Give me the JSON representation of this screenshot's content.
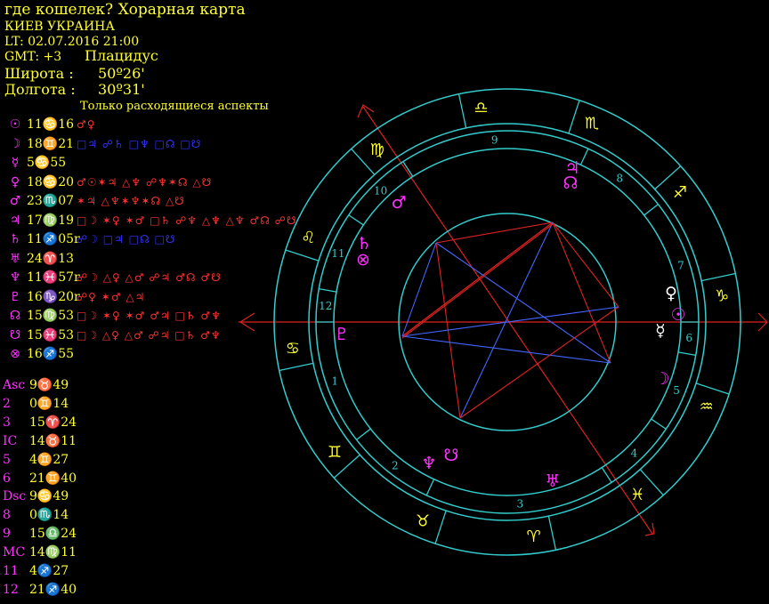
{
  "header": {
    "title": "где кошелек? Хорарная карта",
    "city": "КИЕВ УКРАИНА",
    "local_time": "LT: 02.07.2016  21:00",
    "gmt": "GMT: +3",
    "house_system": "Плацидус",
    "latitude_label": "Широта :",
    "latitude_value": "50º26'",
    "longitude_label": "Долгота :",
    "longitude_value": "30º31'",
    "aspects_note": "Только расходящиеся аспекты"
  },
  "planets": [
    {
      "name": "sun",
      "glyph": "☉",
      "pos": "11♋16",
      "aspects": [
        [
          "♂♀",
          "#ff3333"
        ]
      ]
    },
    {
      "name": "moon",
      "glyph": "☽",
      "pos": "18♊21",
      "aspects": [
        [
          "□♃ ☍♄ □♆ □☊ □☋",
          "#3333ff"
        ]
      ]
    },
    {
      "name": "mercury",
      "glyph": "☿",
      "pos": "5♋55",
      "aspects": []
    },
    {
      "name": "venus",
      "glyph": "♀",
      "pos": "18♋20",
      "aspects": [
        [
          "♂☉✶♃ △♆ ☍♆✶☊ △☋",
          "#ff3333"
        ]
      ]
    },
    {
      "name": "mars",
      "glyph": "♂",
      "pos": "23♏07",
      "aspects": [
        [
          "✶♃ △♆✶♆✶☊ △☋",
          "#ff3333"
        ]
      ]
    },
    {
      "name": "jupiter",
      "glyph": "♃",
      "pos": "17♍19",
      "aspects": [
        [
          "□☽ ✶♀ ✶♂ □♄ ☍♆ △♆ △♆ ♂☊ ☍☋",
          "#ff3333"
        ]
      ]
    },
    {
      "name": "saturn",
      "glyph": "♄",
      "pos": "11♐05r",
      "aspects": [
        [
          "☍☽ □♃ □☊ □☋",
          "#3333ff"
        ]
      ]
    },
    {
      "name": "uranus",
      "glyph": "♅",
      "pos": "24♈13",
      "aspects": []
    },
    {
      "name": "neptune",
      "glyph": "♆",
      "pos": "11♓57r",
      "aspects": [
        [
          "☍☽ △♀ △♂ ☍♃ ♂☊ ♂☋",
          "#ff3333"
        ]
      ]
    },
    {
      "name": "pluto",
      "glyph": "♇",
      "pos": "16♑20r",
      "aspects": [
        [
          "☍♀ ✶♂ △♃",
          "#ff3333"
        ]
      ]
    },
    {
      "name": "north-node",
      "glyph": "☊",
      "pos": "15♍53",
      "aspects": [
        [
          "□☽ ✶♀ ✶♂ ♂♃ □♄ ♂♆",
          "#ff3333"
        ]
      ]
    },
    {
      "name": "south-node",
      "glyph": "☋",
      "pos": "15♓53",
      "aspects": [
        [
          "□☽ △♀ △♂ ☍♃ □♄ ♂♆",
          "#ff3333"
        ]
      ]
    },
    {
      "name": "fortune",
      "glyph": "⊗",
      "pos": "16♐55",
      "aspects": []
    }
  ],
  "cusps": [
    {
      "label": "Asc",
      "pos": "9♉49"
    },
    {
      "label": "2",
      "pos": "0♊14"
    },
    {
      "label": "3",
      "pos": "15♈24"
    },
    {
      "label": "IC",
      "pos": "14♉11"
    },
    {
      "label": "5",
      "pos": "4♊27"
    },
    {
      "label": "6",
      "pos": "21♊40"
    },
    {
      "label": "Dsc",
      "pos": "9♋49"
    },
    {
      "label": "8",
      "pos": "0♏14"
    },
    {
      "label": "9",
      "pos": "15♎24"
    },
    {
      "label": "MC",
      "pos": "14♍11"
    },
    {
      "label": "11",
      "pos": "4♐27"
    },
    {
      "label": "12",
      "pos": "21♐40"
    }
  ],
  "wheel": {
    "zodiac_glyphs": [
      "♎",
      "♍",
      "♌",
      "♋",
      "♊",
      "♉",
      "♈",
      "♓",
      "♒",
      "♑",
      "♐",
      "♏"
    ],
    "house_numbers": [
      "1",
      "2",
      "3",
      "4",
      "5",
      "6",
      "7",
      "8",
      "9",
      "10",
      "11",
      "12"
    ],
    "planet_marks": [
      {
        "glyph": "♃",
        "color": "#ff33ff"
      },
      {
        "glyph": "☊",
        "color": "#ff33ff"
      },
      {
        "glyph": "♂",
        "color": "#ff33ff"
      },
      {
        "glyph": "♄",
        "color": "#ff33ff"
      },
      {
        "glyph": "⊗",
        "color": "#ff33ff"
      },
      {
        "glyph": "♀",
        "color": "#ffffff"
      },
      {
        "glyph": "☉",
        "color": "#ff33ff"
      },
      {
        "glyph": "☿",
        "color": "#ffffff"
      },
      {
        "glyph": "☽",
        "color": "#ff33ff"
      },
      {
        "glyph": "♅",
        "color": "#ff33ff"
      },
      {
        "glyph": "♆",
        "color": "#ff33ff"
      },
      {
        "glyph": "☋",
        "color": "#ff33ff"
      },
      {
        "glyph": "♇",
        "color": "#ff33ff"
      }
    ]
  },
  "colors": {
    "background": "#000000",
    "text": "#ffff33",
    "glyph": "#ff33ff",
    "ring": "#33cccc",
    "hard_aspect": "#dd2222",
    "soft_aspect": "#4466ff"
  }
}
